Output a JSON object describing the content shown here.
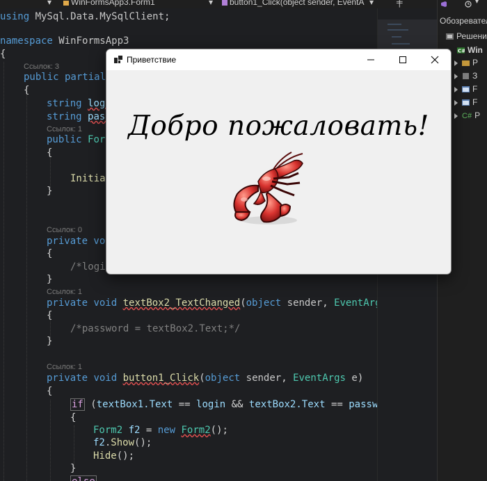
{
  "navbar": {
    "class_path": "WinFormsApp3.Form1",
    "member": "button1_Click(object sender, EventA"
  },
  "code": {
    "line_using": [
      "using ",
      "MySql.Data.MySqlClient",
      ";"
    ],
    "line_namespace_kw": "namespace",
    "line_namespace_name": "WinFormsApp3",
    "brace_open": "{",
    "brace_close": "}",
    "lens_3": "Ссылок: 3",
    "lens_1": "Ссылок: 1",
    "lens_0": "Ссылок: 0",
    "public_partial": "public partial",
    "string_kw": "string",
    "field_login": "logi",
    "field_pass": "pass",
    "public_kw": "public",
    "ctor": "Form",
    "initia": "Initia",
    "private_kw": "private",
    "void_kw": "void",
    "priv_void_trunc": "private voi",
    "comment_login": "/*logi",
    "tb2_method": "textBox2_TextChanged",
    "params_open": "(",
    "object_kw": "object",
    "sender": "sender",
    "eventargs_trunc": "EventArg",
    "comment_password": "/*password = textBox2.Text;*/",
    "button_method": "button1_Click",
    "eventargs": "EventArgs",
    "e_param": "e",
    "if_kw": "if",
    "cond_tb1": "textBox1.Text",
    "cond_eq": "==",
    "cond_login": "login",
    "cond_and": "&&",
    "cond_tb2": "textBox2.Text",
    "cond_pass": "passwo",
    "form2_type": "Form2",
    "f2_var": "f2",
    "new_kw": "new",
    "form2_ctor": "Form2",
    "ctor_tail": "();",
    "show_call": "Show",
    "hide_call": "Hide",
    "else_kw": "else"
  },
  "explorer": {
    "title": "Обозревател",
    "root": "Решени",
    "project": "Win",
    "items": [
      "Р",
      "З",
      "F",
      "F",
      "Р"
    ]
  },
  "dialog": {
    "title": "Приветствие",
    "greeting": "Добро пожаловать!"
  },
  "colors": {
    "editor_bg": "#1e1f22",
    "dialog_bg": "#f0f0f0",
    "keyword": "#569cd6",
    "type": "#4ec9b0",
    "method": "#dcdcaa",
    "comment": "#6a9955",
    "lobster_red": "#d8332f"
  },
  "icons": {
    "app_icon": "winforms-app-icon",
    "minimize": "minimize-icon",
    "maximize": "maximize-icon",
    "close": "close-icon",
    "picture": "lobster-image"
  }
}
